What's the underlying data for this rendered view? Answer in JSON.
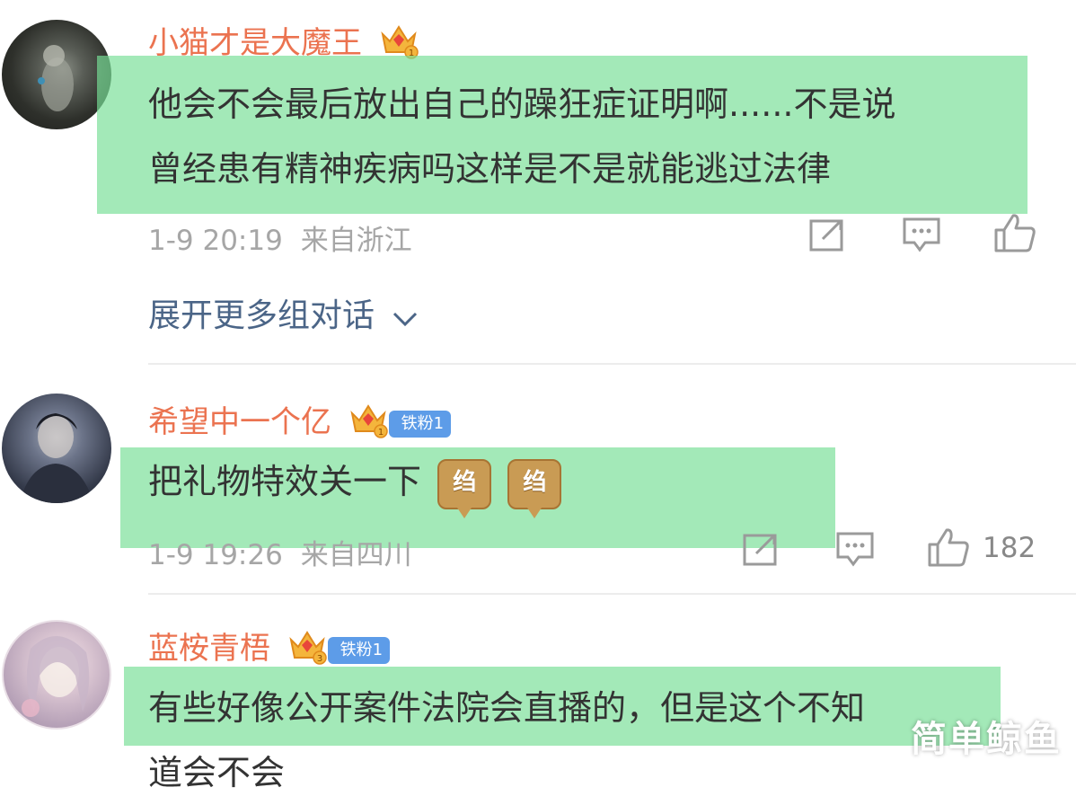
{
  "comments": [
    {
      "username": "小猫才是大魔王",
      "crown_level": "1",
      "lines": [
        "他会不会最后放出自己的躁狂症证明啊......不是说",
        "曾经患有精神疾病吗这样是不是就能逃过法律"
      ],
      "time": "1-9 20:19",
      "location": "来自浙江",
      "likes": ""
    },
    {
      "username": "希望中一个亿",
      "crown_level": "1",
      "fan_badge": "铁粉1",
      "lines": [
        "把礼物特效关一下"
      ],
      "stickers": [
        "绉",
        "绉"
      ],
      "time": "1-9 19:26",
      "location": "来自四川",
      "likes": "182"
    },
    {
      "username": "蓝桉青梧",
      "crown_level": "3",
      "fan_badge": "铁粉1",
      "lines": [
        "有些好像公开案件法院会直播的，但是这个不知",
        "道会不会"
      ]
    }
  ],
  "expand_label": "展开更多组对话",
  "watermark": "简单鲸鱼",
  "colors": {
    "username": "#eb7350",
    "highlight": "#78de96",
    "badge": "#5d9ce8",
    "link": "#4b6587"
  },
  "icons": [
    "repost-icon",
    "comment-icon",
    "like-icon",
    "chevron-down-icon",
    "crown-icon"
  ]
}
